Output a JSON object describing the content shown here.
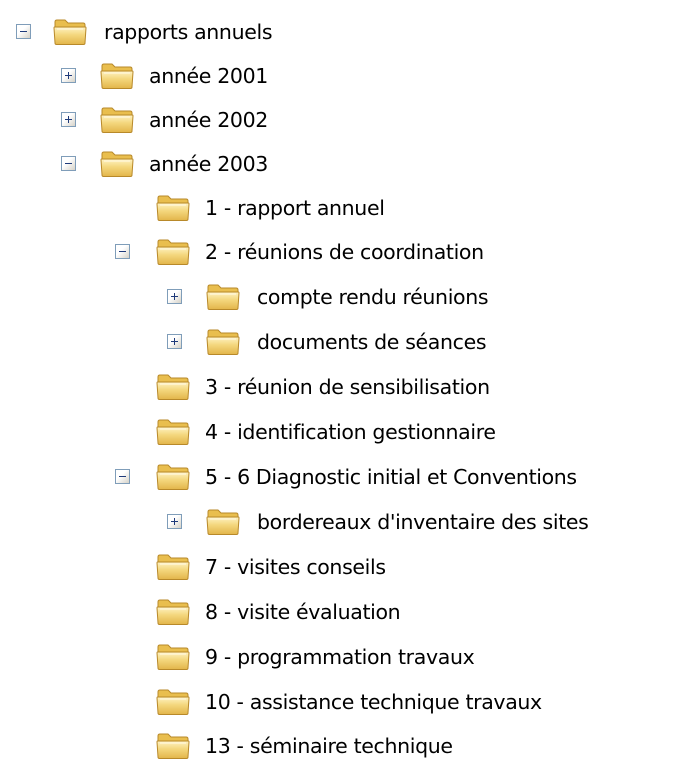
{
  "tree": {
    "root": {
      "label": "rapports annuels",
      "toggle": "minus",
      "icon": "folder-icon"
    },
    "year_2001": {
      "label": "année 2001",
      "toggle": "plus",
      "icon": "folder-icon"
    },
    "year_2002": {
      "label": "année 2002",
      "toggle": "plus",
      "icon": "folder-icon"
    },
    "year_2003": {
      "label": "année 2003",
      "toggle": "minus",
      "icon": "folder-icon"
    },
    "item_1": {
      "label": "1 - rapport annuel",
      "toggle": "none",
      "icon": "folder-icon"
    },
    "item_2": {
      "label": "2 - réunions de coordination",
      "toggle": "minus",
      "icon": "folder-icon"
    },
    "item_2a": {
      "label": "compte rendu réunions",
      "toggle": "plus",
      "icon": "folder-icon"
    },
    "item_2b": {
      "label": "documents de séances",
      "toggle": "plus",
      "icon": "folder-icon"
    },
    "item_3": {
      "label": "3 - réunion de sensibilisation",
      "toggle": "none",
      "icon": "folder-icon"
    },
    "item_4": {
      "label": "4 - identification gestionnaire",
      "toggle": "none",
      "icon": "folder-icon"
    },
    "item_5": {
      "label": "5 - 6 Diagnostic initial et Conventions",
      "toggle": "minus",
      "icon": "folder-icon"
    },
    "item_5a": {
      "label": "bordereaux d'inventaire des sites",
      "toggle": "plus",
      "icon": "folder-icon"
    },
    "item_7": {
      "label": "7 - visites conseils",
      "toggle": "none",
      "icon": "folder-icon"
    },
    "item_8": {
      "label": "8 - visite évaluation",
      "toggle": "none",
      "icon": "folder-icon"
    },
    "item_9": {
      "label": "9 - programmation travaux",
      "toggle": "none",
      "icon": "folder-icon"
    },
    "item_10": {
      "label": "10 - assistance technique travaux",
      "toggle": "none",
      "icon": "folder-icon"
    },
    "item_13": {
      "label": "13 - séminaire technique",
      "toggle": "none",
      "icon": "folder-icon"
    }
  },
  "colors": {
    "folder_body": "#f4d77e",
    "folder_back": "#e9be4e",
    "folder_outline": "#b8892a",
    "toggle_border": "#7f9db9",
    "toggle_glyph": "#1f3a7a"
  }
}
